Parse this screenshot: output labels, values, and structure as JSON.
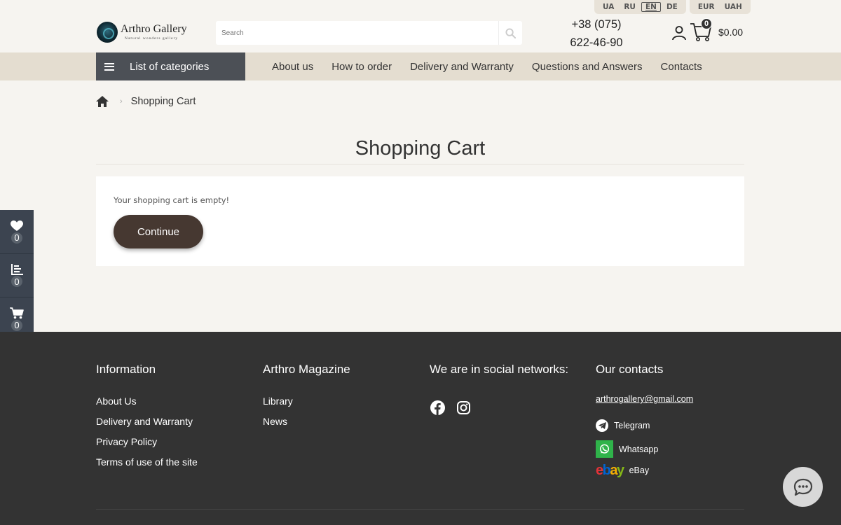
{
  "languages": [
    "UA",
    "RU",
    "EN",
    "DE"
  ],
  "active_language": "EN",
  "currencies": [
    "EUR",
    "UAH"
  ],
  "logo": {
    "title": "Arthro Gallery",
    "subtitle": "Natural wonders gallery"
  },
  "search": {
    "placeholder": "Search"
  },
  "phone": {
    "line1": "+38 (075)",
    "line2": "622-46-90"
  },
  "cart": {
    "count": "0",
    "total": "$0.00"
  },
  "nav": {
    "categories_label": "List of categories",
    "links": [
      "About us",
      "How to order",
      "Delivery and Warranty",
      "Questions and Answers",
      "Contacts"
    ]
  },
  "breadcrumb": {
    "current": "Shopping Cart"
  },
  "page": {
    "title": "Shopping Cart",
    "empty_message": "Your shopping cart is empty!",
    "continue_label": "Continue"
  },
  "side_widget": {
    "wishlist_count": "0",
    "compare_count": "0",
    "cart_count": "0"
  },
  "footer": {
    "information": {
      "heading": "Information",
      "links": [
        "About Us",
        "Delivery and Warranty",
        "Privacy Policy",
        "Terms of use of the site"
      ]
    },
    "magazine": {
      "heading": "Arthro Magazine",
      "links": [
        "Library",
        "News"
      ]
    },
    "social": {
      "heading": "We are in social networks:"
    },
    "contacts": {
      "heading": "Our contacts",
      "email": "arthrogallery@gmail.com",
      "telegram": "Telegram",
      "whatsapp": "Whatsapp",
      "ebay": "eBay"
    }
  },
  "colors": {
    "accent_brown": "#463831",
    "nav_bg": "#e4ddd0",
    "footer_bg": "#333333",
    "side_bg": "#3c4450"
  }
}
